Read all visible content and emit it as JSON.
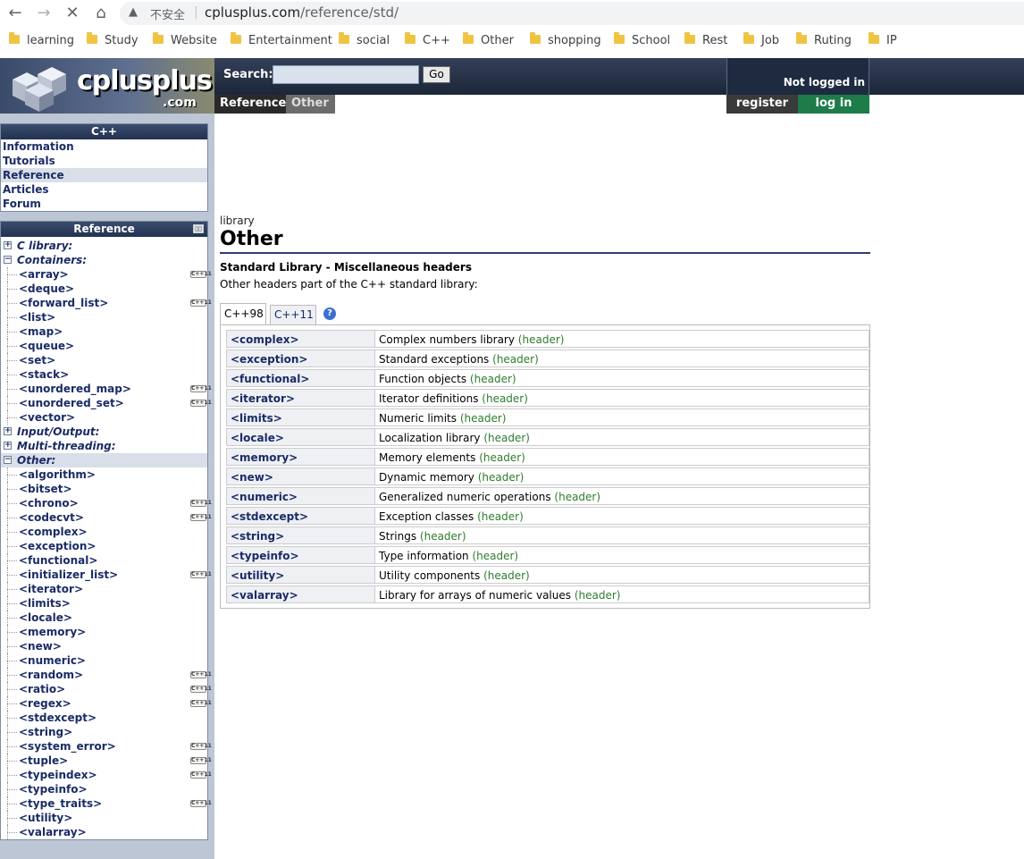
{
  "browser": {
    "insecure_label": "不安全",
    "url_host": "cplusplus.com",
    "url_path": "/reference/std/",
    "bookmarks": [
      "learning",
      "Study",
      "Website",
      "Entertainment",
      "social",
      "C++",
      "Other",
      "shopping",
      "School",
      "Rest",
      "Job",
      "Ruting",
      "IP"
    ]
  },
  "header": {
    "logo_text": "cplusplus",
    "logo_suffix": ".com",
    "search_label": "Search:",
    "search_value": "",
    "go_label": "Go",
    "breadcrumb": [
      "Reference",
      "Other"
    ],
    "login_status": "Not logged in",
    "register_label": "register",
    "login_label": "log in"
  },
  "sidebar": {
    "cpp_title": "C++",
    "cpp_items": [
      "Information",
      "Tutorials",
      "Reference",
      "Articles",
      "Forum"
    ],
    "cpp_selected": "Reference",
    "ref_title": "Reference",
    "tree": [
      {
        "label": "C library:",
        "type": "cat",
        "expanded": false
      },
      {
        "label": "Containers:",
        "type": "cat",
        "expanded": true
      },
      {
        "label": "<array>",
        "type": "leaf",
        "cpp11": true
      },
      {
        "label": "<deque>",
        "type": "leaf",
        "cpp11": false
      },
      {
        "label": "<forward_list>",
        "type": "leaf",
        "cpp11": true
      },
      {
        "label": "<list>",
        "type": "leaf",
        "cpp11": false
      },
      {
        "label": "<map>",
        "type": "leaf",
        "cpp11": false
      },
      {
        "label": "<queue>",
        "type": "leaf",
        "cpp11": false
      },
      {
        "label": "<set>",
        "type": "leaf",
        "cpp11": false
      },
      {
        "label": "<stack>",
        "type": "leaf",
        "cpp11": false
      },
      {
        "label": "<unordered_map>",
        "type": "leaf",
        "cpp11": true
      },
      {
        "label": "<unordered_set>",
        "type": "leaf",
        "cpp11": true
      },
      {
        "label": "<vector>",
        "type": "leaf",
        "cpp11": false
      },
      {
        "label": "Input/Output:",
        "type": "cat",
        "expanded": false
      },
      {
        "label": "Multi-threading:",
        "type": "cat",
        "expanded": false
      },
      {
        "label": "Other:",
        "type": "cat",
        "expanded": true,
        "selected": true
      },
      {
        "label": "<algorithm>",
        "type": "leaf",
        "cpp11": false
      },
      {
        "label": "<bitset>",
        "type": "leaf",
        "cpp11": false
      },
      {
        "label": "<chrono>",
        "type": "leaf",
        "cpp11": true
      },
      {
        "label": "<codecvt>",
        "type": "leaf",
        "cpp11": true
      },
      {
        "label": "<complex>",
        "type": "leaf",
        "cpp11": false
      },
      {
        "label": "<exception>",
        "type": "leaf",
        "cpp11": false
      },
      {
        "label": "<functional>",
        "type": "leaf",
        "cpp11": false
      },
      {
        "label": "<initializer_list>",
        "type": "leaf",
        "cpp11": true
      },
      {
        "label": "<iterator>",
        "type": "leaf",
        "cpp11": false
      },
      {
        "label": "<limits>",
        "type": "leaf",
        "cpp11": false
      },
      {
        "label": "<locale>",
        "type": "leaf",
        "cpp11": false
      },
      {
        "label": "<memory>",
        "type": "leaf",
        "cpp11": false
      },
      {
        "label": "<new>",
        "type": "leaf",
        "cpp11": false
      },
      {
        "label": "<numeric>",
        "type": "leaf",
        "cpp11": false
      },
      {
        "label": "<random>",
        "type": "leaf",
        "cpp11": true
      },
      {
        "label": "<ratio>",
        "type": "leaf",
        "cpp11": true
      },
      {
        "label": "<regex>",
        "type": "leaf",
        "cpp11": true
      },
      {
        "label": "<stdexcept>",
        "type": "leaf",
        "cpp11": false
      },
      {
        "label": "<string>",
        "type": "leaf",
        "cpp11": false
      },
      {
        "label": "<system_error>",
        "type": "leaf",
        "cpp11": true
      },
      {
        "label": "<tuple>",
        "type": "leaf",
        "cpp11": true
      },
      {
        "label": "<typeindex>",
        "type": "leaf",
        "cpp11": true
      },
      {
        "label": "<typeinfo>",
        "type": "leaf",
        "cpp11": false
      },
      {
        "label": "<type_traits>",
        "type": "leaf",
        "cpp11": true
      },
      {
        "label": "<utility>",
        "type": "leaf",
        "cpp11": false
      },
      {
        "label": "<valarray>",
        "type": "leaf",
        "cpp11": false
      }
    ],
    "cpp11_badge": "C++11"
  },
  "main": {
    "kind": "library",
    "title": "Other",
    "subtitle": "Standard Library - Miscellaneous headers",
    "description": "Other headers part of the C++ standard library:",
    "tabs": [
      "C++98",
      "C++11"
    ],
    "active_tab": "C++98",
    "help_icon": "?",
    "header_tag": "(header)",
    "rows": [
      {
        "name": "<complex>",
        "desc": "Complex numbers library"
      },
      {
        "name": "<exception>",
        "desc": "Standard exceptions"
      },
      {
        "name": "<functional>",
        "desc": "Function objects"
      },
      {
        "name": "<iterator>",
        "desc": "Iterator definitions"
      },
      {
        "name": "<limits>",
        "desc": "Numeric limits"
      },
      {
        "name": "<locale>",
        "desc": "Localization library"
      },
      {
        "name": "<memory>",
        "desc": "Memory elements"
      },
      {
        "name": "<new>",
        "desc": "Dynamic memory"
      },
      {
        "name": "<numeric>",
        "desc": "Generalized numeric operations"
      },
      {
        "name": "<stdexcept>",
        "desc": "Exception classes"
      },
      {
        "name": "<string>",
        "desc": "Strings"
      },
      {
        "name": "<typeinfo>",
        "desc": "Type information"
      },
      {
        "name": "<utility>",
        "desc": "Utility components"
      },
      {
        "name": "<valarray>",
        "desc": "Library for arrays of numeric values"
      }
    ]
  }
}
